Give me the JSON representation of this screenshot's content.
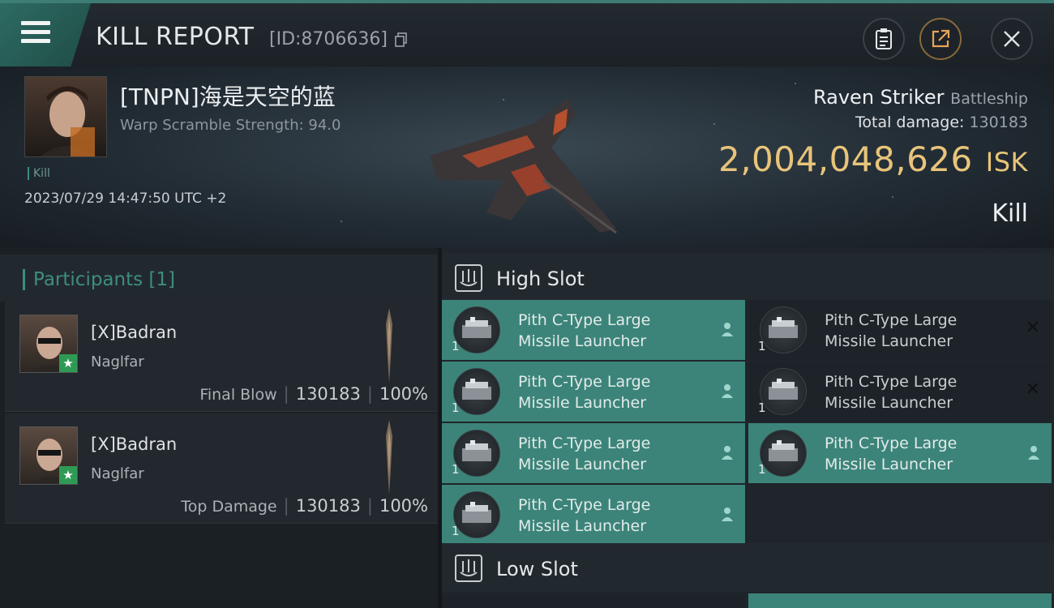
{
  "header": {
    "title": "KILL REPORT",
    "id_text": "[ID:8706636]",
    "icons": [
      "menu-icon",
      "copy-icon",
      "clipboard-icon",
      "share-icon",
      "close-icon"
    ]
  },
  "victim": {
    "name": "[TNPN]海是天空的蓝",
    "warp_scramble": "Warp Scramble Strength: 94.0",
    "tag": "Kill",
    "datetime": "2023/07/29 14:47:50 UTC +2",
    "ship_name": "Raven Striker",
    "ship_class": "Battleship",
    "total_damage_label": "Total damage:",
    "total_damage": "130183",
    "isk_value": "2,004,048,626",
    "isk_unit": "ISK",
    "result": "Kill"
  },
  "participants": {
    "title": "Participants [1]",
    "rows": [
      {
        "name": "[X]Badran",
        "ship": "Naglfar",
        "label": "Final Blow",
        "damage": "130183",
        "percent": "100%"
      },
      {
        "name": "[X]Badran",
        "ship": "Naglfar",
        "label": "Top Damage",
        "damage": "130183",
        "percent": "100%"
      }
    ]
  },
  "fitting": {
    "high_slot_title": "High Slot",
    "low_slot_title": "Low Slot",
    "module_line1": "Pith C-Type Large",
    "module_line2": "Missile Launcher",
    "module_qty": "1",
    "colors": {
      "active": "#3c8479",
      "idle": "#1d2328",
      "accent": "#3d8d80",
      "isk": "#e8c47a"
    }
  }
}
